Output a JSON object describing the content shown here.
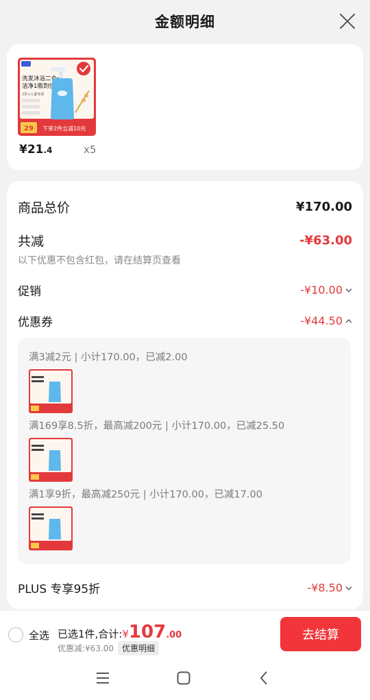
{
  "header": {
    "title": "金额明细"
  },
  "product": {
    "thumb": {
      "badge": "家庭装",
      "line1": "洗发沐浴二合一",
      "line2": "洁净1瓶到位",
      "line3": "3岁+儿童专研",
      "promo": "下单2件立减10元",
      "price_tag": "29"
    },
    "price_int": "¥21",
    "price_dec": ".4",
    "qty": "x5"
  },
  "summary": {
    "total_label": "商品总价",
    "total_value": "¥170.00",
    "reduce_label": "共减",
    "reduce_value": "-¥63.00",
    "note": "以下优惠不包含红包，请在结算页查看",
    "promo_label": "促销",
    "promo_value": "-¥10.00",
    "coupon_label": "优惠券",
    "coupon_value": "-¥44.50",
    "plus_label": "PLUS 专享95折",
    "plus_value": "-¥8.50"
  },
  "coupons": [
    {
      "text": "满3减2元 | 小计170.00，已减2.00"
    },
    {
      "text": "满169享8.5折，最高减200元 | 小计170.00，已减25.50"
    },
    {
      "text": "满1享9折，最高减250元 | 小计170.00，已减17.00"
    }
  ],
  "bottom": {
    "select_all": "全选",
    "selected_text": "已选1件,合计:",
    "currency": "¥",
    "total_int": "107",
    "total_dec": ".00",
    "discount_text": "优惠减:¥63.00",
    "detail_tag": "优惠明细",
    "checkout": "去结算"
  },
  "colors": {
    "accent": "#e4393c",
    "button": "#f2353a"
  }
}
